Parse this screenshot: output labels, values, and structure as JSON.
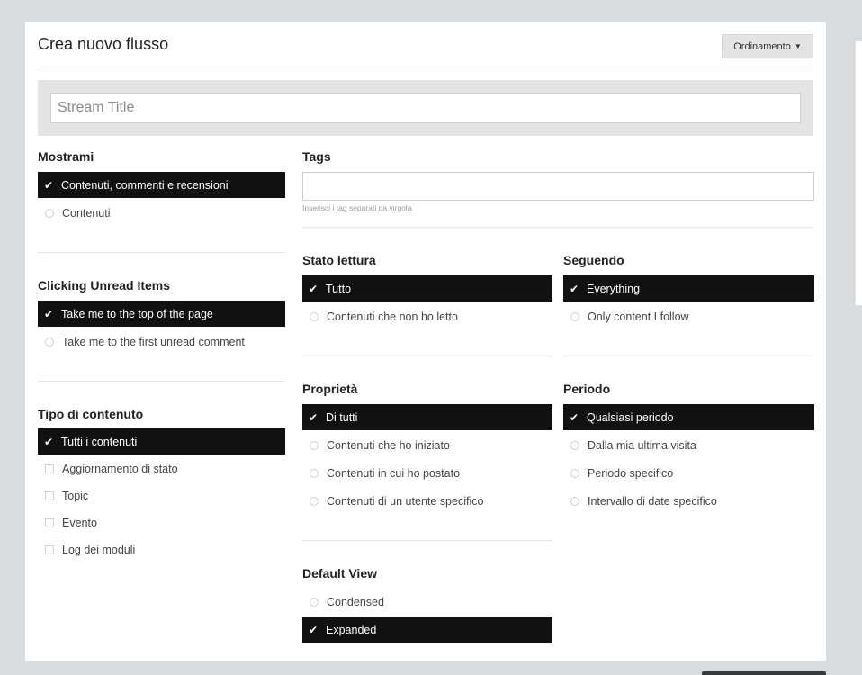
{
  "header": {
    "title": "Crea nuovo flusso",
    "sort_label": "Ordinamento"
  },
  "stream_title": {
    "placeholder": "Stream Title",
    "value": ""
  },
  "mostrami": {
    "title": "Mostrami",
    "options": [
      {
        "label": "Contenuti, commenti e recensioni",
        "selected": true
      },
      {
        "label": "Contenuti",
        "selected": false
      }
    ]
  },
  "clicking": {
    "title": "Clicking Unread Items",
    "options": [
      {
        "label": "Take me to the top of the page",
        "selected": true
      },
      {
        "label": "Take me to the first unread comment",
        "selected": false
      }
    ]
  },
  "tipo": {
    "title": "Tipo di contenuto",
    "options": [
      {
        "label": "Tutti i contenuti",
        "selected": true
      },
      {
        "label": "Aggiornamento di stato",
        "selected": false
      },
      {
        "label": "Topic",
        "selected": false
      },
      {
        "label": "Evento",
        "selected": false
      },
      {
        "label": "Log dei moduli",
        "selected": false
      }
    ]
  },
  "tags": {
    "title": "Tags",
    "value": "",
    "help": "Inserisci i tag separati da virgola."
  },
  "stato": {
    "title": "Stato lettura",
    "options": [
      {
        "label": "Tutto",
        "selected": true
      },
      {
        "label": "Contenuti che non ho letto",
        "selected": false
      }
    ]
  },
  "seguendo": {
    "title": "Seguendo",
    "options": [
      {
        "label": "Everything",
        "selected": true
      },
      {
        "label": "Only content I follow",
        "selected": false
      }
    ]
  },
  "proprieta": {
    "title": "Proprietà",
    "options": [
      {
        "label": "Di tutti",
        "selected": true
      },
      {
        "label": "Contenuti che ho iniziato",
        "selected": false
      },
      {
        "label": "Contenuti in cui ho postato",
        "selected": false
      },
      {
        "label": "Contenuti di un utente specifico",
        "selected": false
      }
    ]
  },
  "periodo": {
    "title": "Periodo",
    "options": [
      {
        "label": "Qualsiasi periodo",
        "selected": true
      },
      {
        "label": "Dalla mia ultima visita",
        "selected": false
      },
      {
        "label": "Periodo specifico",
        "selected": false
      },
      {
        "label": "Intervallo di date specifico",
        "selected": false
      }
    ]
  },
  "default_view": {
    "title": "Default View",
    "options": [
      {
        "label": "Condensed",
        "selected": false
      },
      {
        "label": "Expanded",
        "selected": true
      }
    ]
  },
  "icons": {
    "check": "check-icon",
    "radio": "radio-empty-icon",
    "checkbox": "checkbox-empty-icon",
    "caret": "caret-down-icon"
  },
  "colors": {
    "selected_bg": "#111111",
    "panel_bg": "#ffffff",
    "page_bg": "#d9dcdf",
    "title_bar_bg": "#e4e4e4"
  }
}
